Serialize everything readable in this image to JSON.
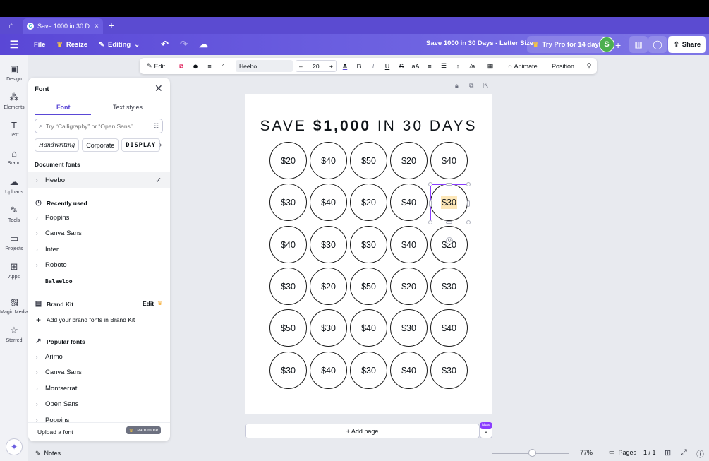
{
  "browser": {
    "tab_title": "Save 1000 in 30 D...",
    "favicon_letter": "C",
    "new_tab": "+"
  },
  "header": {
    "file": "File",
    "resize": "Resize",
    "mode": "Editing",
    "doc_title": "Save 1000 in 30 Days - Letter Size",
    "pro_btn": "Try Pro for 14 days",
    "avatar": "S",
    "share": "Share"
  },
  "rail": {
    "items": [
      "Design",
      "Elements",
      "Text",
      "Brand",
      "Uploads",
      "Tools",
      "Projects",
      "Apps",
      "Magic Media",
      "Starred"
    ]
  },
  "font_panel": {
    "title": "Font",
    "tabs": [
      "Font",
      "Text styles"
    ],
    "search_placeholder": "Try “Calligraphy” or “Open Sans”",
    "chips": [
      "Handwriting",
      "Corporate",
      "DISPLAY"
    ],
    "document_fonts_heading": "Document fonts",
    "document_fonts": [
      "Heebo"
    ],
    "recent_heading": "Recently used",
    "recent": [
      "Poppins",
      "Canva Sans",
      "Inter",
      "Roboto",
      "Balaeloo"
    ],
    "brand_kit_heading": "Brand Kit",
    "brand_kit_edit": "Edit",
    "brand_kit_add": "Add your brand fonts in Brand Kit",
    "popular_heading": "Popular fonts",
    "popular": [
      "Arimo",
      "Canva Sans",
      "Montserrat",
      "Open Sans",
      "Poppins"
    ],
    "upload": "Upload a font",
    "learn_more": "Learn more"
  },
  "toolbar": {
    "edit": "Edit",
    "font": "Heebo",
    "size": "20",
    "minus": "–",
    "plus": "+",
    "bold": "B",
    "italic": "I",
    "underline": "U",
    "strike": "S",
    "case": "aA",
    "animate": "Animate",
    "position": "Position"
  },
  "design": {
    "title_pre": "SAVE ",
    "title_bold": "$1,000",
    "title_post": " IN 30 DAYS",
    "rows": [
      [
        "$20",
        "$40",
        "$50",
        "$20",
        "$40"
      ],
      [
        "$30",
        "$40",
        "$20",
        "$40",
        "$30"
      ],
      [
        "$40",
        "$30",
        "$30",
        "$40",
        "$20"
      ],
      [
        "$30",
        "$20",
        "$50",
        "$20",
        "$30"
      ],
      [
        "$50",
        "$30",
        "$40",
        "$30",
        "$40"
      ],
      [
        "$30",
        "$40",
        "$30",
        "$40",
        "$30"
      ]
    ],
    "selected": {
      "row": 1,
      "col": 4
    }
  },
  "canvas": {
    "add_page": "+ Add page",
    "new_badge": "New"
  },
  "bottom": {
    "notes": "Notes",
    "zoom": "77%",
    "zoom_fraction": 0.52,
    "pages": "Pages",
    "page_count": "1 / 1"
  }
}
